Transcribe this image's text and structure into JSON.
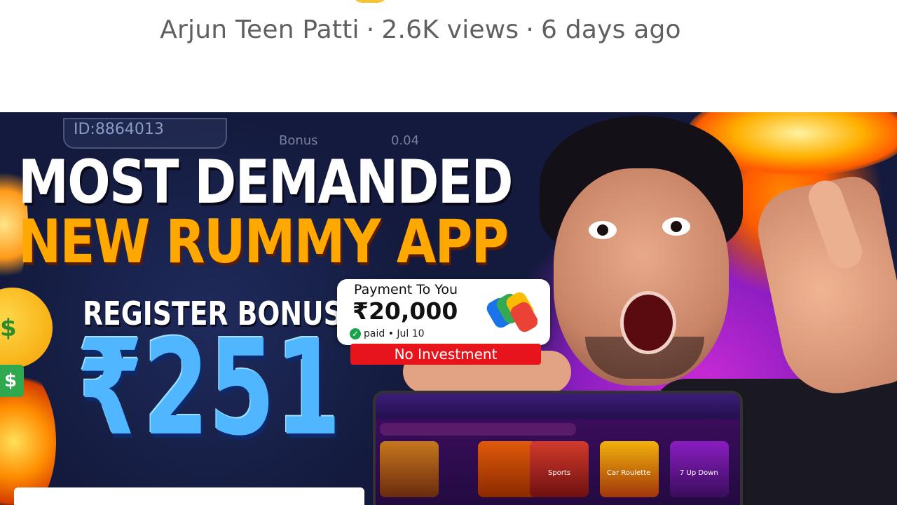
{
  "video_meta": {
    "channel": "Arjun Teen Patti",
    "separator": "·",
    "views": "2.6K views",
    "age": "6 days ago"
  },
  "thumbnail": {
    "id_label": "ID:8864013",
    "bonus_ghost": "Bonus",
    "bonus_ghost_value": "0.04",
    "headline_1": "MOST DEMANDED",
    "headline_2": "NEW RUMMY APP",
    "register_label": "REGISTER BONUS",
    "register_amount": "₹251",
    "payment_card": {
      "title": "Payment To You",
      "amount": "₹20,000",
      "status": "paid • Jul 10",
      "banner": "No Investment"
    },
    "phone_labels": {
      "sports": "Sports",
      "car": "Car Roulette",
      "updown": "7 Up Down"
    }
  },
  "icons": [
    "money-face-icon",
    "gpay-icon",
    "check-icon"
  ],
  "colors": {
    "meta_text": "#606060",
    "headline_white": "#ffffff",
    "headline_orange": "#ffa800",
    "big_amount_blue": "#4fb6ff",
    "no_investment_red": "#e8141c"
  }
}
